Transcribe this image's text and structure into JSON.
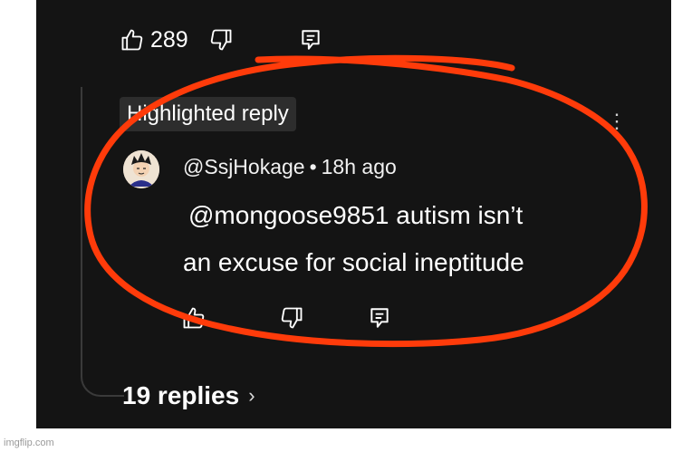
{
  "top_actions": {
    "like_count": "289",
    "icons": [
      "thumbs-up-icon",
      "thumbs-down-icon",
      "reply-icon"
    ]
  },
  "highlighted_badge": "Highlighted reply",
  "comment": {
    "author": "@SsjHokage",
    "separator": "•",
    "time": "18h ago",
    "text_line1": "@mongoose9851 autism isn’t",
    "text_line2": "an excuse for social ineptitude"
  },
  "reply_actions": {
    "icons": [
      "thumbs-up-icon",
      "thumbs-down-icon",
      "reply-icon"
    ]
  },
  "replies_link": {
    "label": "19 replies",
    "chevron": "›"
  },
  "annotation_color": "#ff3b0a",
  "watermark": "imgflip.com"
}
